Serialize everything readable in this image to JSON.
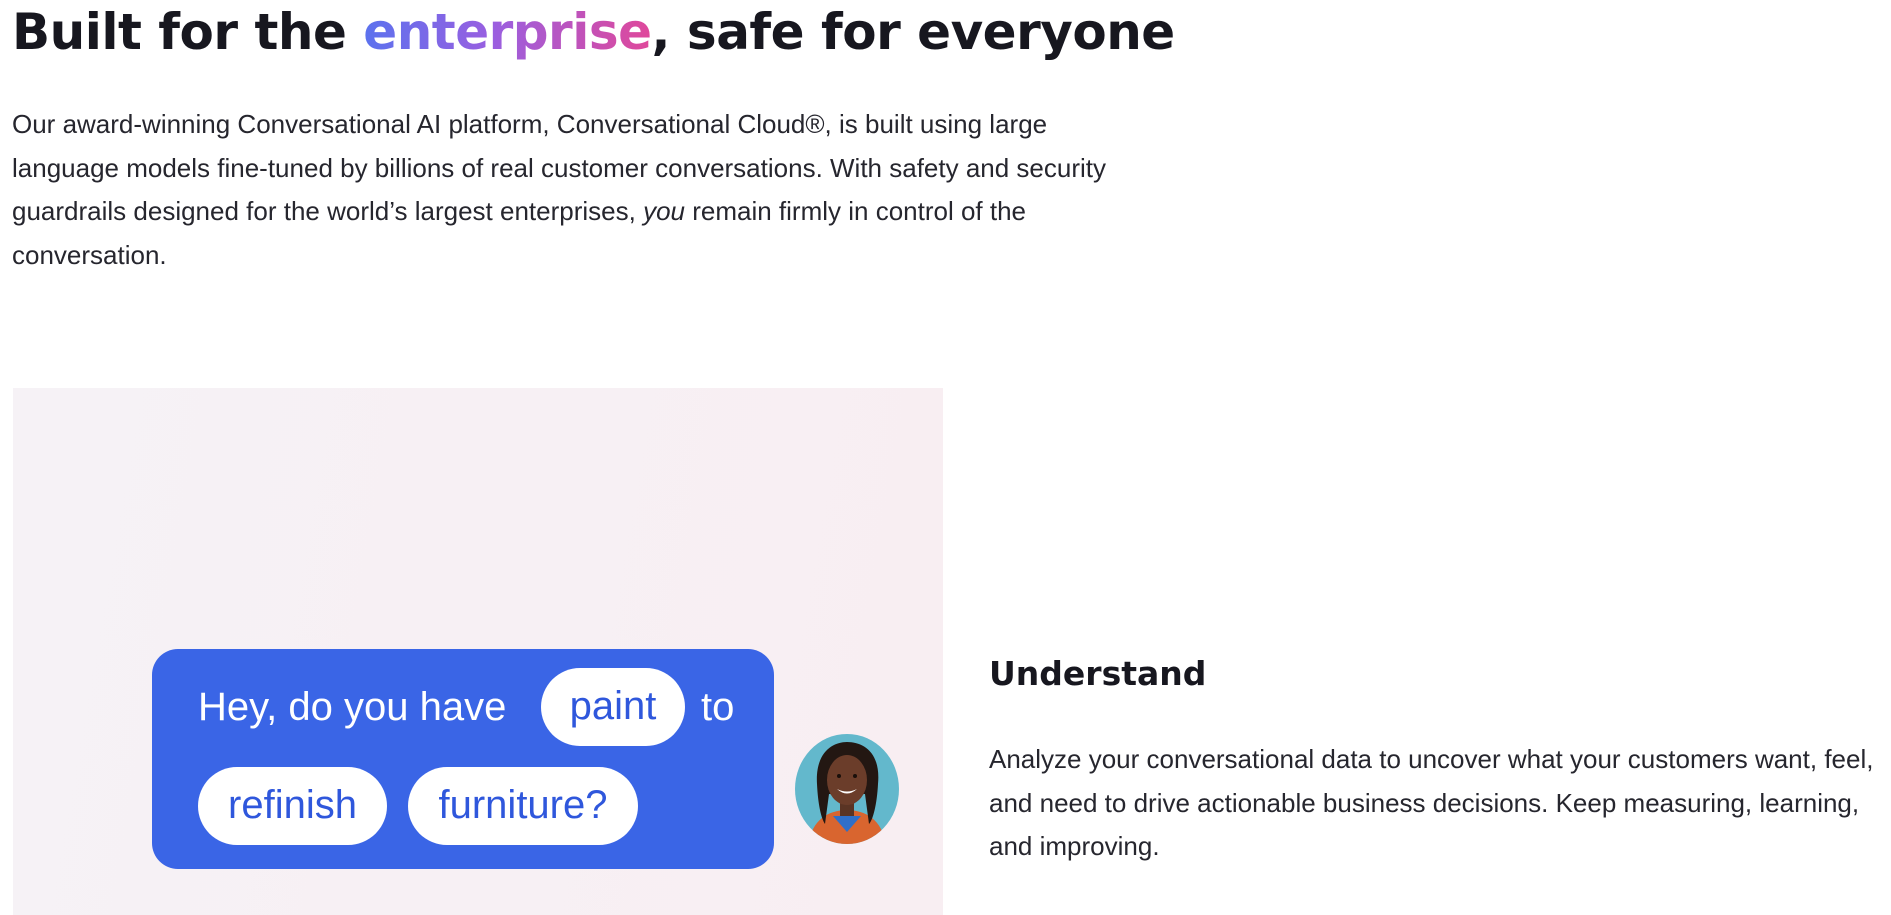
{
  "hero": {
    "title_before": "Built for the ",
    "title_accent": "enterprise",
    "title_after": ", safe for everyone",
    "intro_part1": "Our award-winning Conversational AI platform, Conversational Cloud®, is built using large language models fine-tuned by billions of real customer conversations. With safety and security guardrails designed for the world’s largest enterprises, ",
    "intro_emphasis": "you",
    "intro_part2": " remain firmly in control of the conversation."
  },
  "chat": {
    "text_1": "Hey, do you have",
    "chip_1": "paint",
    "text_2": "to",
    "chip_2": "refinish",
    "chip_3": "furniture?"
  },
  "feature": {
    "title": "Understand",
    "description": "Analyze your conversational data to uncover what your customers want, feel, and need to drive actionable business decisions. Keep measuring, learning, and improving."
  },
  "colors": {
    "accent_gradient_start": "#5b72ee",
    "accent_gradient_end": "#e0489a",
    "chat_bubble": "#3a65e6",
    "panel_background": "#f7f0f4",
    "avatar_background": "#63b8cc"
  }
}
